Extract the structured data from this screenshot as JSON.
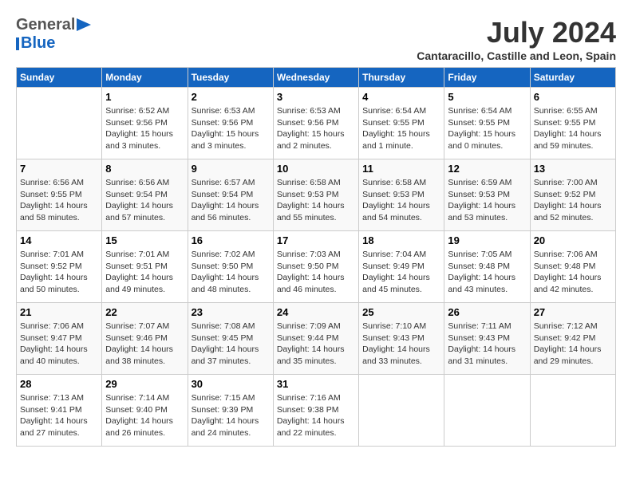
{
  "header": {
    "logo": {
      "general": "General",
      "blue": "Blue"
    },
    "month_year": "July 2024",
    "location": "Cantaracillo, Castille and Leon, Spain"
  },
  "days_of_week": [
    "Sunday",
    "Monday",
    "Tuesday",
    "Wednesday",
    "Thursday",
    "Friday",
    "Saturday"
  ],
  "weeks": [
    [
      {
        "day": "",
        "info": ""
      },
      {
        "day": "1",
        "info": "Sunrise: 6:52 AM\nSunset: 9:56 PM\nDaylight: 15 hours\nand 3 minutes."
      },
      {
        "day": "2",
        "info": "Sunrise: 6:53 AM\nSunset: 9:56 PM\nDaylight: 15 hours\nand 3 minutes."
      },
      {
        "day": "3",
        "info": "Sunrise: 6:53 AM\nSunset: 9:56 PM\nDaylight: 15 hours\nand 2 minutes."
      },
      {
        "day": "4",
        "info": "Sunrise: 6:54 AM\nSunset: 9:55 PM\nDaylight: 15 hours\nand 1 minute."
      },
      {
        "day": "5",
        "info": "Sunrise: 6:54 AM\nSunset: 9:55 PM\nDaylight: 15 hours\nand 0 minutes."
      },
      {
        "day": "6",
        "info": "Sunrise: 6:55 AM\nSunset: 9:55 PM\nDaylight: 14 hours\nand 59 minutes."
      }
    ],
    [
      {
        "day": "7",
        "info": "Sunrise: 6:56 AM\nSunset: 9:55 PM\nDaylight: 14 hours\nand 58 minutes."
      },
      {
        "day": "8",
        "info": "Sunrise: 6:56 AM\nSunset: 9:54 PM\nDaylight: 14 hours\nand 57 minutes."
      },
      {
        "day": "9",
        "info": "Sunrise: 6:57 AM\nSunset: 9:54 PM\nDaylight: 14 hours\nand 56 minutes."
      },
      {
        "day": "10",
        "info": "Sunrise: 6:58 AM\nSunset: 9:53 PM\nDaylight: 14 hours\nand 55 minutes."
      },
      {
        "day": "11",
        "info": "Sunrise: 6:58 AM\nSunset: 9:53 PM\nDaylight: 14 hours\nand 54 minutes."
      },
      {
        "day": "12",
        "info": "Sunrise: 6:59 AM\nSunset: 9:53 PM\nDaylight: 14 hours\nand 53 minutes."
      },
      {
        "day": "13",
        "info": "Sunrise: 7:00 AM\nSunset: 9:52 PM\nDaylight: 14 hours\nand 52 minutes."
      }
    ],
    [
      {
        "day": "14",
        "info": "Sunrise: 7:01 AM\nSunset: 9:52 PM\nDaylight: 14 hours\nand 50 minutes."
      },
      {
        "day": "15",
        "info": "Sunrise: 7:01 AM\nSunset: 9:51 PM\nDaylight: 14 hours\nand 49 minutes."
      },
      {
        "day": "16",
        "info": "Sunrise: 7:02 AM\nSunset: 9:50 PM\nDaylight: 14 hours\nand 48 minutes."
      },
      {
        "day": "17",
        "info": "Sunrise: 7:03 AM\nSunset: 9:50 PM\nDaylight: 14 hours\nand 46 minutes."
      },
      {
        "day": "18",
        "info": "Sunrise: 7:04 AM\nSunset: 9:49 PM\nDaylight: 14 hours\nand 45 minutes."
      },
      {
        "day": "19",
        "info": "Sunrise: 7:05 AM\nSunset: 9:48 PM\nDaylight: 14 hours\nand 43 minutes."
      },
      {
        "day": "20",
        "info": "Sunrise: 7:06 AM\nSunset: 9:48 PM\nDaylight: 14 hours\nand 42 minutes."
      }
    ],
    [
      {
        "day": "21",
        "info": "Sunrise: 7:06 AM\nSunset: 9:47 PM\nDaylight: 14 hours\nand 40 minutes."
      },
      {
        "day": "22",
        "info": "Sunrise: 7:07 AM\nSunset: 9:46 PM\nDaylight: 14 hours\nand 38 minutes."
      },
      {
        "day": "23",
        "info": "Sunrise: 7:08 AM\nSunset: 9:45 PM\nDaylight: 14 hours\nand 37 minutes."
      },
      {
        "day": "24",
        "info": "Sunrise: 7:09 AM\nSunset: 9:44 PM\nDaylight: 14 hours\nand 35 minutes."
      },
      {
        "day": "25",
        "info": "Sunrise: 7:10 AM\nSunset: 9:43 PM\nDaylight: 14 hours\nand 33 minutes."
      },
      {
        "day": "26",
        "info": "Sunrise: 7:11 AM\nSunset: 9:43 PM\nDaylight: 14 hours\nand 31 minutes."
      },
      {
        "day": "27",
        "info": "Sunrise: 7:12 AM\nSunset: 9:42 PM\nDaylight: 14 hours\nand 29 minutes."
      }
    ],
    [
      {
        "day": "28",
        "info": "Sunrise: 7:13 AM\nSunset: 9:41 PM\nDaylight: 14 hours\nand 27 minutes."
      },
      {
        "day": "29",
        "info": "Sunrise: 7:14 AM\nSunset: 9:40 PM\nDaylight: 14 hours\nand 26 minutes."
      },
      {
        "day": "30",
        "info": "Sunrise: 7:15 AM\nSunset: 9:39 PM\nDaylight: 14 hours\nand 24 minutes."
      },
      {
        "day": "31",
        "info": "Sunrise: 7:16 AM\nSunset: 9:38 PM\nDaylight: 14 hours\nand 22 minutes."
      },
      {
        "day": "",
        "info": ""
      },
      {
        "day": "",
        "info": ""
      },
      {
        "day": "",
        "info": ""
      }
    ]
  ]
}
